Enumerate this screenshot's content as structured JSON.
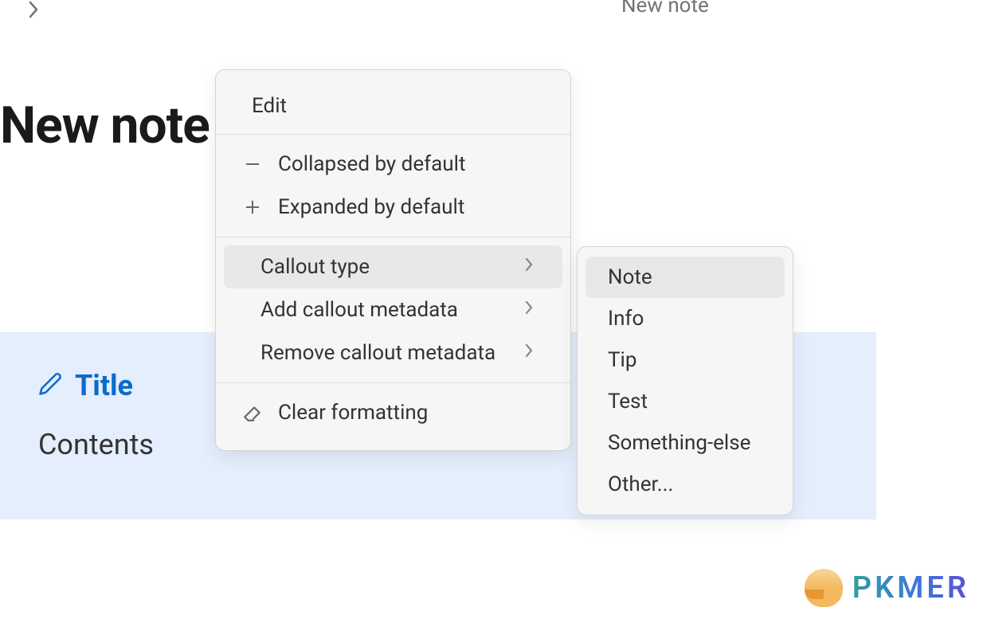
{
  "header": {
    "partial_text": "New note"
  },
  "note": {
    "title": "New note"
  },
  "callout": {
    "title": "Title",
    "contents": "Contents"
  },
  "context_menu": {
    "header": "Edit",
    "items": {
      "collapsed": "Collapsed by default",
      "expanded": "Expanded by default",
      "callout_type": "Callout type",
      "add_metadata": "Add callout metadata",
      "remove_metadata": "Remove callout metadata",
      "clear_formatting": "Clear formatting"
    }
  },
  "submenu": {
    "options": {
      "note": "Note",
      "info": "Info",
      "tip": "Tip",
      "test": "Test",
      "something_else": "Something-else",
      "other": "Other..."
    }
  },
  "watermark": {
    "text": "PKMER"
  }
}
